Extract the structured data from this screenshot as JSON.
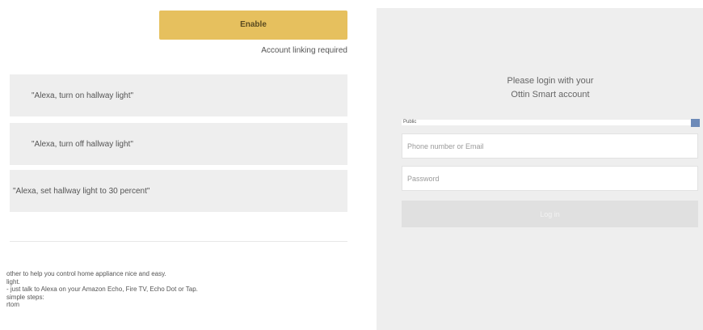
{
  "skill": {
    "enable_label": "Enable",
    "linking_note": "Account linking required",
    "utterances": [
      "\"Alexa, turn on hallway light\"",
      "\"Alexa, turn off hallway light\"",
      "\"Alexa, set hallway light to 30 percent\""
    ],
    "description_lines": [
      "other to help you control home appliance nice and easy.",
      "light.",
      "- just talk to Alexa on your Amazon Echo, Fire TV, Echo Dot or Tap.",
      "simple steps:",
      "rtom"
    ],
    "colors": {
      "enable_button": "#e6c05e",
      "utterance_bg": "#eeeeee"
    }
  },
  "login": {
    "title_line1": "Please login with your",
    "title_line2": "Ottin Smart account",
    "region_value": "Public",
    "phone_placeholder": "Phone number or Email",
    "password_placeholder": "Password",
    "login_label": "Log in",
    "colors": {
      "panel_bg": "#eeeeee",
      "select_handle": "#6d8ab8"
    }
  }
}
